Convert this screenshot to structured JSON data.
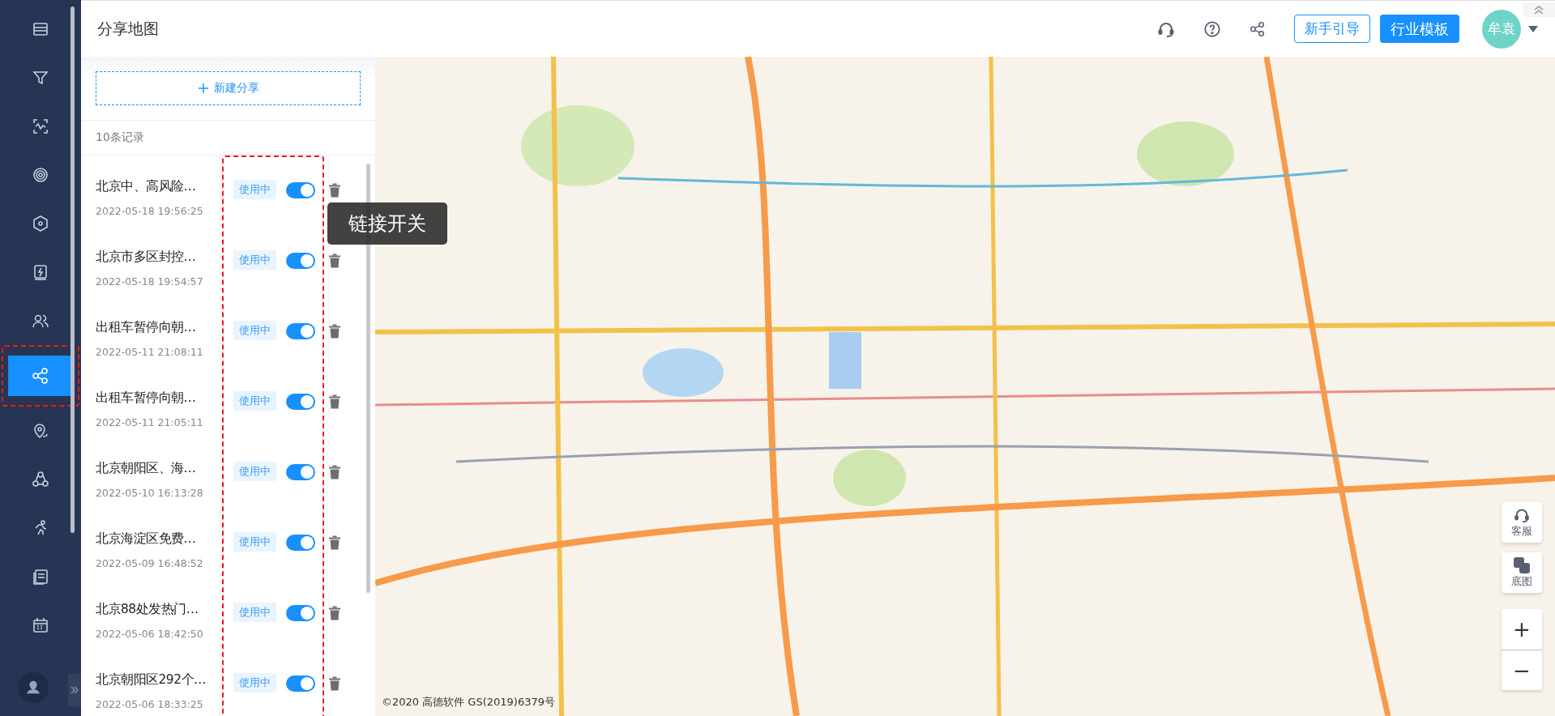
{
  "sidebar": {
    "items": [
      {
        "selected": false
      },
      {
        "selected": false
      },
      {
        "selected": false
      },
      {
        "selected": false
      },
      {
        "selected": false
      },
      {
        "selected": false
      },
      {
        "selected": false
      },
      {
        "selected": true,
        "highlighted": true
      },
      {
        "selected": false
      },
      {
        "selected": false
      },
      {
        "selected": false
      },
      {
        "selected": false
      },
      {
        "selected": false
      }
    ]
  },
  "header": {
    "title": "分享地图",
    "guide_button": "新手引导",
    "template_button": "行业模板",
    "avatar": "牟袁"
  },
  "panel": {
    "new_button": "新建分享",
    "count": "10条记录",
    "toggles_highlighted": true,
    "items": [
      {
        "title": "北京中、高风险…",
        "date": "2022-05-18 19:56:25",
        "status": "使用中",
        "on": true
      },
      {
        "title": "北京市多区封控…",
        "date": "2022-05-18 19:54:57",
        "status": "使用中",
        "on": true
      },
      {
        "title": "出租车暂停向朝…",
        "date": "2022-05-11 21:08:11",
        "status": "使用中",
        "on": true
      },
      {
        "title": "出租车暂停向朝…",
        "date": "2022-05-11 21:05:11",
        "status": "使用中",
        "on": true
      },
      {
        "title": "北京朝阳区、海…",
        "date": "2022-05-10 16:13:28",
        "status": "使用中",
        "on": true
      },
      {
        "title": "北京海淀区免费…",
        "date": "2022-05-09 16:48:52",
        "status": "使用中",
        "on": true
      },
      {
        "title": "北京88处发热门…",
        "date": "2022-05-06 18:42:50",
        "status": "使用中",
        "on": true
      },
      {
        "title": "北京朝阳区292个…",
        "date": "2022-05-06 18:33:25",
        "status": "使用中",
        "on": true
      }
    ]
  },
  "tooltip": "链接开关",
  "map": {
    "kind": "picture",
    "service_button": "客服",
    "basemap_button": "底图",
    "zoom_in": "+",
    "zoom_out": "−",
    "copyright": "©2020 高德软件 GS(2019)6379号"
  }
}
